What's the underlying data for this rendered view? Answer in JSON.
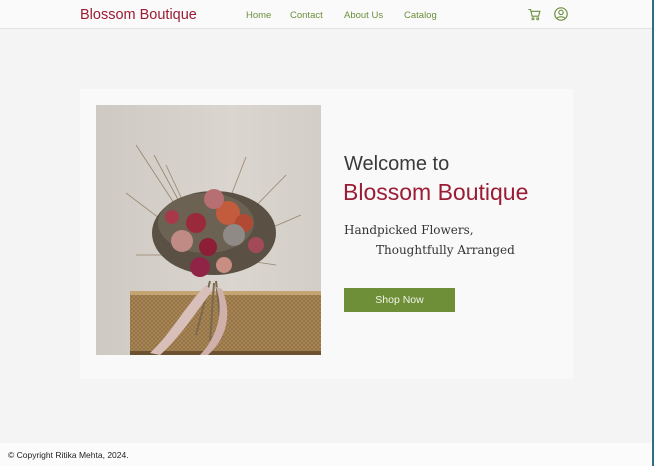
{
  "header": {
    "brand": "Blossom Boutique",
    "nav": [
      {
        "label": "Home"
      },
      {
        "label": "Contact"
      },
      {
        "label": "About Us"
      },
      {
        "label": "Catalog"
      }
    ],
    "icons": [
      "cart-icon",
      "account-icon"
    ]
  },
  "hero": {
    "welcome": "Welcome to",
    "brand": "Blossom Boutique",
    "tagline_line1": "Handpicked Flowers,",
    "tagline_line2": "Thoughtfully Arranged",
    "cta_label": "Shop Now"
  },
  "footer": {
    "copyright": "© Copyright Ritika Mehta, 2024."
  },
  "colors": {
    "brand": "#9b1c34",
    "nav": "#6c8f3c",
    "button": "#6e8f37",
    "background": "#f4f4f4"
  }
}
